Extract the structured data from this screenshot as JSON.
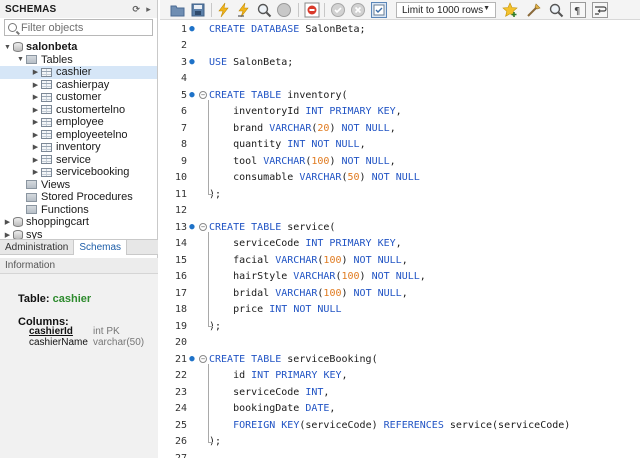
{
  "schemas": {
    "header": "SCHEMAS",
    "filter_placeholder": "Filter objects",
    "db_current": "salonbeta",
    "tables_label": "Tables",
    "tables": [
      "cashier",
      "cashierpay",
      "customer",
      "customertelno",
      "employee",
      "employeetelno",
      "inventory",
      "service",
      "servicebooking"
    ],
    "selected_table": "cashier",
    "other_folders": [
      "Views",
      "Stored Procedures",
      "Functions"
    ],
    "other_dbs": [
      "shoppingcart",
      "sys"
    ]
  },
  "bottom_tabs": [
    "Administration",
    "Schemas"
  ],
  "active_bottom_tab": "Schemas",
  "info": {
    "header": "Information",
    "table_label": "Table:",
    "table_name": "cashier",
    "columns_label": "Columns:",
    "columns": [
      {
        "name": "cashierId",
        "type": "int PK"
      },
      {
        "name": "cashierName",
        "type": "varchar(50)"
      }
    ]
  },
  "toolbar": {
    "limit_label": "Limit to 1000 rows",
    "icons": [
      "open-folder-icon",
      "save-icon",
      "execute-icon",
      "execute-current-icon",
      "explain-icon",
      "stop-icon",
      "toggle-error-icon",
      "commit-icon",
      "rollback-icon",
      "autocommit-icon",
      "add-snippet-icon",
      "beautify-icon",
      "find-icon",
      "invisible-chars-icon",
      "wrap-icon"
    ]
  },
  "editor": {
    "lines": [
      "CREATE DATABASE SalonBeta;",
      "",
      "USE SalonBeta;",
      "",
      "CREATE TABLE inventory(",
      "    inventoryId INT PRIMARY KEY,",
      "    brand VARCHAR(20) NOT NULL,",
      "    quantity INT NOT NULL,",
      "    tool VARCHAR(100) NOT NULL,",
      "    consumable VARCHAR(50) NOT NULL",
      ");",
      "",
      "CREATE TABLE service(",
      "    serviceCode INT PRIMARY KEY,",
      "    facial VARCHAR(100) NOT NULL,",
      "    hairStyle VARCHAR(100) NOT NULL,",
      "    bridal VARCHAR(100) NOT NULL,",
      "    price INT NOT NULL",
      ");",
      "",
      "CREATE TABLE serviceBooking(",
      "    id INT PRIMARY KEY,",
      "    serviceCode INT,",
      "    bookingDate DATE,",
      "    FOREIGN KEY(serviceCode) REFERENCES service(serviceCode)",
      ");",
      ""
    ]
  },
  "colors": {
    "keyword": "#2154c4",
    "number": "#e07a1f",
    "selected_row": "#d6e6f7",
    "table_name": "#2e8b2e",
    "marker": "#1e72c8"
  }
}
